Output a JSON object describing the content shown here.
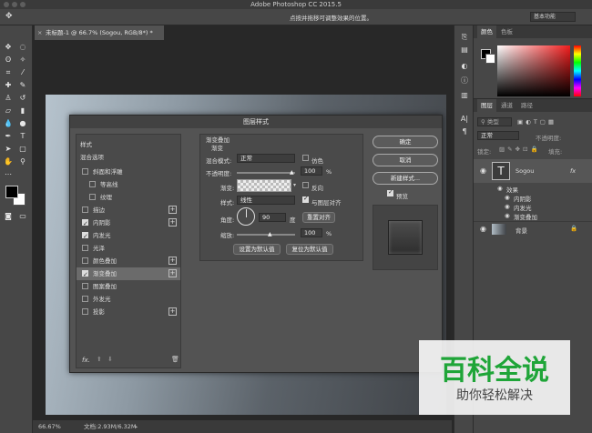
{
  "titlebar": {
    "title": "Adobe Photoshop CC 2015.5"
  },
  "options_bar": {
    "hint": "点按并拖移可调整效果的位置。",
    "workspace": "基本功能"
  },
  "document": {
    "tab": "未标题-1 @ 66.7% (Sogou, RGB/8*) *",
    "zoom": "66.67%",
    "docinfo": "文档:2.93M/6.32M"
  },
  "color_panel": {
    "tabs": [
      "颜色",
      "色板"
    ]
  },
  "layers_panel": {
    "tabs": [
      "图层",
      "通道",
      "路径"
    ],
    "filter": "类型",
    "blend": "正常",
    "opacity_label": "不透明度:",
    "fill_label": "填充:",
    "lock_label": "锁定:",
    "layer_name": "Sogou",
    "fx": "fx",
    "effects_label": "效果",
    "effects": [
      "内阴影",
      "内发光",
      "渐变叠加"
    ],
    "bg_layer": "背景"
  },
  "dialog": {
    "title": "图层样式",
    "styles_header": "样式",
    "blend_options": "混合选项",
    "styles": [
      {
        "label": "斜面和浮雕",
        "checked": false,
        "plus": false,
        "indent": false
      },
      {
        "label": "等高线",
        "checked": false,
        "plus": false,
        "indent": true
      },
      {
        "label": "纹理",
        "checked": false,
        "plus": false,
        "indent": true
      },
      {
        "label": "描边",
        "checked": false,
        "plus": true,
        "indent": false
      },
      {
        "label": "内阴影",
        "checked": true,
        "plus": true,
        "indent": false
      },
      {
        "label": "内发光",
        "checked": true,
        "plus": false,
        "indent": false
      },
      {
        "label": "光泽",
        "checked": false,
        "plus": false,
        "indent": false
      },
      {
        "label": "颜色叠加",
        "checked": false,
        "plus": true,
        "indent": false
      },
      {
        "label": "渐变叠加",
        "checked": true,
        "plus": true,
        "indent": false,
        "selected": true
      },
      {
        "label": "图案叠加",
        "checked": false,
        "plus": false,
        "indent": false
      },
      {
        "label": "外发光",
        "checked": false,
        "plus": false,
        "indent": false
      },
      {
        "label": "投影",
        "checked": false,
        "plus": true,
        "indent": false
      }
    ],
    "fx_label": "fx.",
    "section_title": "渐变叠加",
    "section_sub": "渐变",
    "blend_mode_label": "混合模式:",
    "blend_mode": "正常",
    "dither": "仿色",
    "opacity_label": "不透明度:",
    "opacity": "100",
    "percent": "%",
    "gradient_label": "渐变:",
    "reverse": "反向",
    "style_label": "样式:",
    "style_value": "线性",
    "align_layer": "与图层对齐",
    "angle_label": "角度:",
    "angle": "90",
    "degree": "度",
    "reset_align": "重置对齐",
    "scale_label": "缩放:",
    "scale": "100",
    "make_default": "设置为默认值",
    "reset_default": "复位为默认值",
    "ok": "确定",
    "cancel": "取消",
    "new_style": "新建样式...",
    "preview": "预览"
  },
  "watermark": {
    "title": "百科全说",
    "subtitle": "助你轻松解决"
  }
}
